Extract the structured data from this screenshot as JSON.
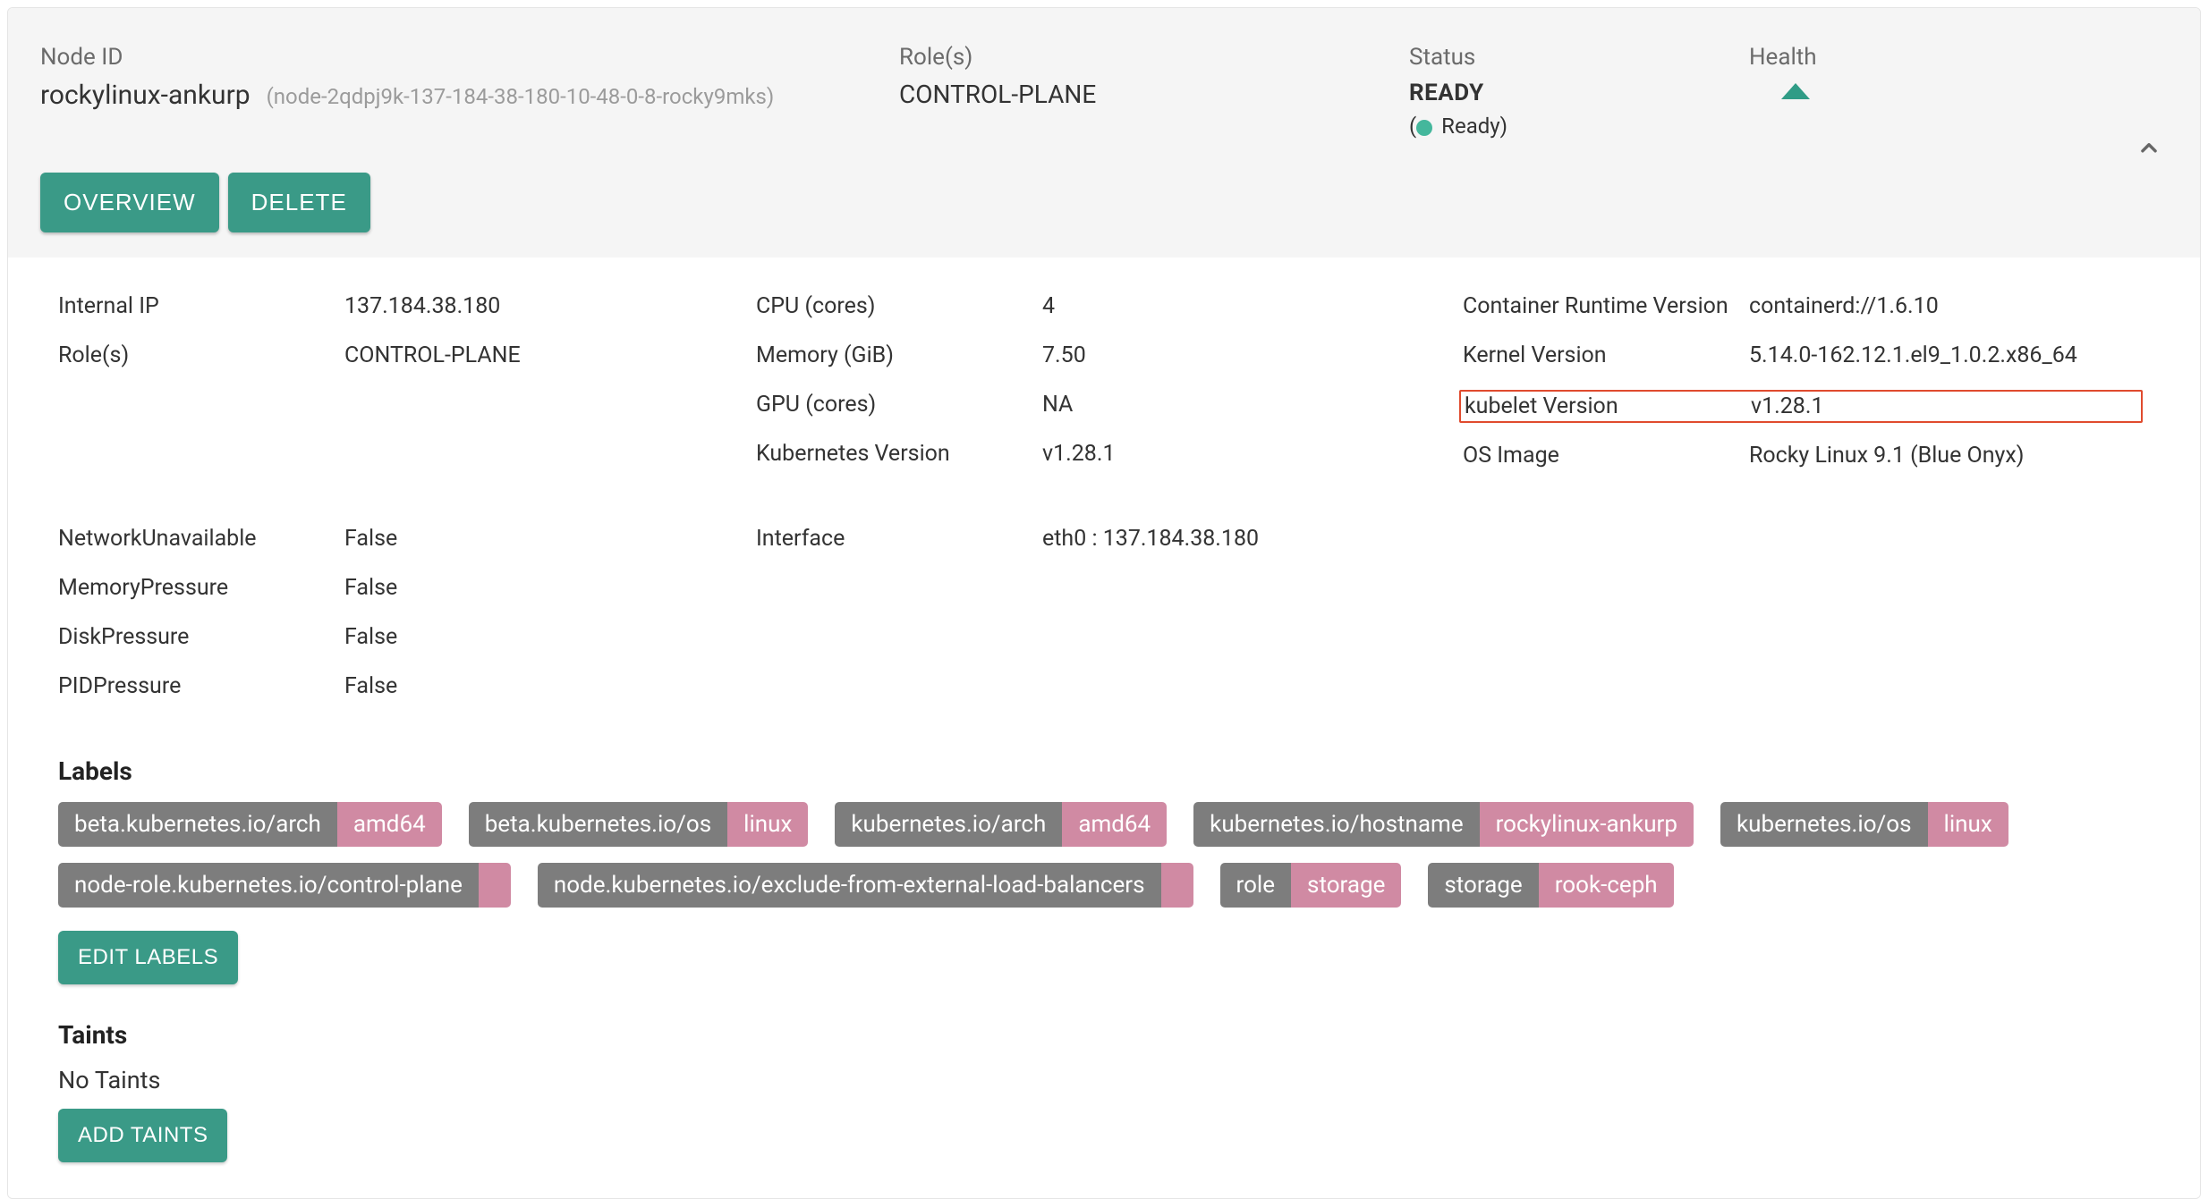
{
  "header": {
    "nodeIdLabel": "Node ID",
    "nodeName": "rockylinux-ankurp",
    "nodeSub": "(node-2qdpj9k-137-184-38-180-10-48-0-8-rocky9mks)",
    "rolesLabel": "Role(s)",
    "rolesValue": "CONTROL-PLANE",
    "statusLabel": "Status",
    "statusValue": "READY",
    "statusChip": "Ready",
    "healthLabel": "Health",
    "overviewBtn": "OVERVIEW",
    "deleteBtn": "DELETE"
  },
  "info": {
    "col1": [
      {
        "k": "Internal IP",
        "v": "137.184.38.180"
      },
      {
        "k": "Role(s)",
        "v": "CONTROL-PLANE"
      }
    ],
    "col2": [
      {
        "k": "CPU (cores)",
        "v": "4"
      },
      {
        "k": "Memory (GiB)",
        "v": "7.50"
      },
      {
        "k": "GPU (cores)",
        "v": "NA"
      },
      {
        "k": "Kubernetes Version",
        "v": "v1.28.1"
      }
    ],
    "col3": [
      {
        "k": "Container Runtime Version",
        "v": "containerd://1.6.10"
      },
      {
        "k": "Kernel Version",
        "v": "5.14.0-162.12.1.el9_1.0.2.x86_64"
      },
      {
        "k": "kubelet Version",
        "v": "v1.28.1",
        "highlight": true
      },
      {
        "k": "OS Image",
        "v": "Rocky Linux 9.1 (Blue Onyx)"
      }
    ]
  },
  "conditions": {
    "col1": [
      {
        "k": "NetworkUnavailable",
        "v": "False"
      },
      {
        "k": "MemoryPressure",
        "v": "False"
      },
      {
        "k": "DiskPressure",
        "v": "False"
      },
      {
        "k": "PIDPressure",
        "v": "False"
      }
    ],
    "col2": [
      {
        "k": "Interface",
        "v": "eth0 : 137.184.38.180"
      }
    ]
  },
  "labelsSection": {
    "title": "Labels",
    "chips": [
      {
        "k": "beta.kubernetes.io/arch",
        "v": "amd64"
      },
      {
        "k": "beta.kubernetes.io/os",
        "v": "linux"
      },
      {
        "k": "kubernetes.io/arch",
        "v": "amd64"
      },
      {
        "k": "kubernetes.io/hostname",
        "v": "rockylinux-ankurp"
      },
      {
        "k": "kubernetes.io/os",
        "v": "linux"
      },
      {
        "k": "node-role.kubernetes.io/control-plane",
        "v": ""
      },
      {
        "k": "node.kubernetes.io/exclude-from-external-load-balancers",
        "v": ""
      },
      {
        "k": "role",
        "v": "storage"
      },
      {
        "k": "storage",
        "v": "rook-ceph"
      }
    ],
    "editBtn": "EDIT LABELS"
  },
  "taintsSection": {
    "title": "Taints",
    "none": "No Taints",
    "addBtn": "ADD TAINTS"
  }
}
